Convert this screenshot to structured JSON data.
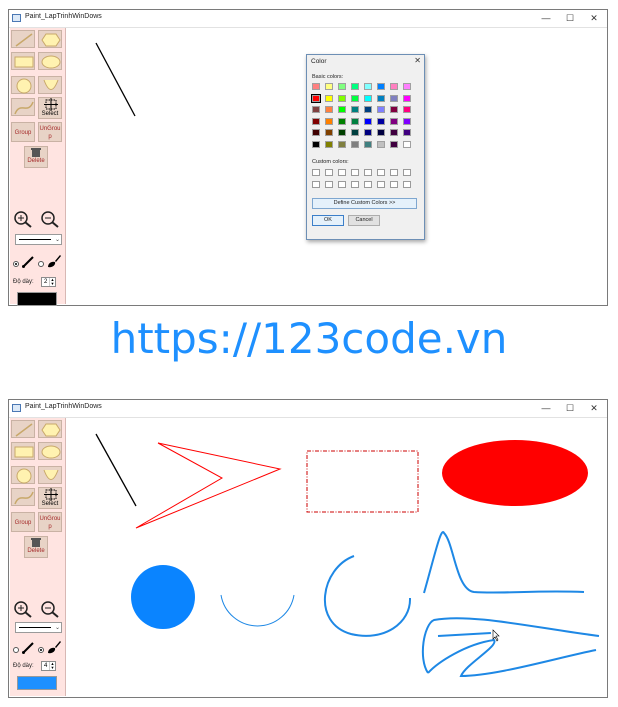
{
  "watermark": {
    "url": "https://123code.vn"
  },
  "window": {
    "title": "Paint_LapTrinhWinDows",
    "minimize_glyph": "—",
    "maximize_glyph": "☐",
    "close_glyph": "✕"
  },
  "toolbar": {
    "group_label": "Group",
    "ungroup_label": "UnGrou p",
    "select_label": "Select",
    "delete_label": "Delete",
    "thickness_label": "Độ dày:"
  },
  "top_state": {
    "thickness_value": "2",
    "color_swatch": "#000000",
    "pen_mode": "pen"
  },
  "bottom_state": {
    "thickness_value": "4",
    "color_swatch": "#1e90ff",
    "pen_mode": "brush"
  },
  "color_dialog": {
    "title": "Color",
    "close_glyph": "✕",
    "basic_colors_label": "Basic colors:",
    "custom_colors_label": "Custom colors:",
    "define_button": "Define Custom Colors >>",
    "ok_button": "OK",
    "cancel_button": "Cancel",
    "basic_colors": [
      [
        "#ff8080",
        "#ffff80",
        "#80ff80",
        "#00ff80",
        "#80ffff",
        "#0080ff",
        "#ff80c0",
        "#ff80ff"
      ],
      [
        "#ff0000",
        "#ffff00",
        "#80ff00",
        "#00ff40",
        "#00ffff",
        "#0080c0",
        "#8080c0",
        "#ff00ff"
      ],
      [
        "#804040",
        "#ff8040",
        "#00ff00",
        "#008080",
        "#004080",
        "#8080ff",
        "#800040",
        "#ff0080"
      ],
      [
        "#800000",
        "#ff8000",
        "#008000",
        "#008040",
        "#0000ff",
        "#0000a0",
        "#800080",
        "#8000ff"
      ],
      [
        "#400000",
        "#804000",
        "#004000",
        "#004040",
        "#000080",
        "#000040",
        "#400040",
        "#400080"
      ],
      [
        "#000000",
        "#808000",
        "#808040",
        "#808080",
        "#408080",
        "#c0c0c0",
        "#400040",
        "#ffffff"
      ]
    ],
    "selected_color": "#ff0000"
  },
  "canvas_colors": {
    "black_line": "#000000",
    "red": "#ff0000",
    "dash_red": "#cc0000",
    "blue": "#1e88e5",
    "blue_fill": "#0a84ff"
  }
}
